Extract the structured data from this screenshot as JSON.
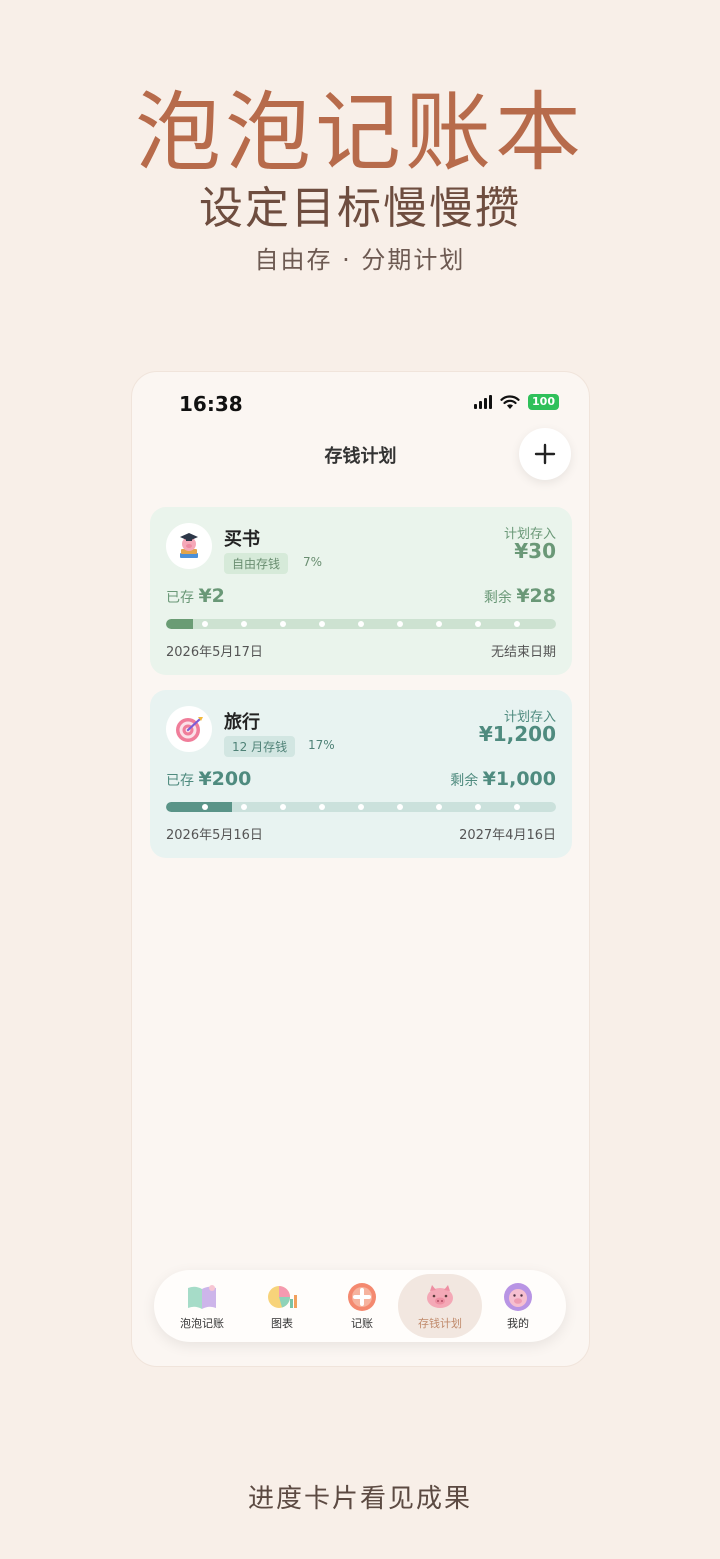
{
  "hero": {
    "title": "泡泡记账本",
    "subtitle": "设定目标慢慢攒",
    "tags": "自由存 · 分期计划"
  },
  "footer": {
    "caption": "进度卡片看见成果"
  },
  "status_bar": {
    "time": "16:38",
    "battery": "100"
  },
  "header": {
    "title": "存钱计划",
    "add_icon": "plus-icon"
  },
  "plans": [
    {
      "name": "买书",
      "icon": "graduation-pig-icon",
      "type_tag": "自由存钱",
      "percent": "7%",
      "progress": 0.07,
      "plan_label": "计划存入",
      "plan_amount": "¥30",
      "saved_label": "已存",
      "saved_amount": "¥2",
      "remain_label": "剩余",
      "remain_amount": "¥28",
      "start_date": "2026年5月17日",
      "end_date": "无结束日期",
      "color": "#6a9c74"
    },
    {
      "name": "旅行",
      "icon": "target-dart-icon",
      "type_tag": "12 月存钱",
      "percent": "17%",
      "progress": 0.17,
      "plan_label": "计划存入",
      "plan_amount": "¥1,200",
      "saved_label": "已存",
      "saved_amount": "¥200",
      "remain_label": "剩余",
      "remain_amount": "¥1,000",
      "start_date": "2026年5月16日",
      "end_date": "2027年4月16日",
      "color": "#5a9488"
    }
  ],
  "tabbar": {
    "active": 3,
    "items": [
      {
        "label": "泡泡记账",
        "icon": "notebook-icon"
      },
      {
        "label": "图表",
        "icon": "pie-chart-icon"
      },
      {
        "label": "记账",
        "icon": "plus-circle-icon"
      },
      {
        "label": "存钱计划",
        "icon": "piggy-bank-icon"
      },
      {
        "label": "我的",
        "icon": "pig-avatar-icon"
      }
    ]
  }
}
